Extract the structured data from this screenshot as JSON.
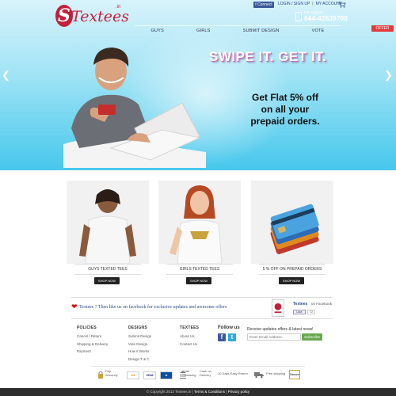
{
  "brand": {
    "logo_letter": "S",
    "name": "Textees",
    "tld": ".in"
  },
  "header": {
    "facebook_connect": "f Connect",
    "login": "LOGIN / SIGN UP",
    "account": "MY ACCOUNT",
    "cart_count": "0",
    "support_label": "For Support",
    "support_phone": "044-42639700"
  },
  "nav": {
    "items": [
      "GUYS",
      "GIRLS",
      "SUBMIT DESIGN",
      "VOTE"
    ]
  },
  "offer_tab": "OFFER",
  "hero": {
    "headline": "SWIPE IT. GET IT.",
    "offer_line1": "Get Flat 5% off",
    "offer_line2": "on all your",
    "offer_line3": "prepaid orders."
  },
  "products": [
    {
      "title": "GUYS TEXTED TEES",
      "button": "SHOP NOW"
    },
    {
      "title": "GIRLS TEXTED TEES",
      "button": "SHOP NOW"
    },
    {
      "title": "5 % OFF ON PREPAID ORDERS",
      "button": "SHOP NOW"
    }
  ],
  "facebook_banner": {
    "text": "Textees ? Then like us on facebook for exclusive updates and awesome offers",
    "page_name": "Textees",
    "page_on": "on Facebook",
    "like_label": "Like",
    "like_count": "72"
  },
  "footer": {
    "policies": {
      "title": "POLICIES",
      "items": [
        "Cancel / Return",
        "Shipping & Delivery",
        "Payment"
      ]
    },
    "designs": {
      "title": "DESIGNS",
      "items": [
        "Submit Design",
        "Vote Design",
        "How it Works",
        "Design T & C"
      ]
    },
    "textees": {
      "title": "TEXTEES",
      "items": [
        "About Us",
        "Contact Us"
      ]
    },
    "follow_title": "Follow us",
    "newsletter_title": "Receive updates offers & latest news!",
    "email_placeholder": "Enter Email Address",
    "subscribe_label": "Subscribe"
  },
  "payments": {
    "pay_securely": "Pay Securely",
    "visa": "VISA",
    "net_banking": "Net Banking",
    "cod": "Cash on Delivery",
    "returns": "10 Days Easy Return",
    "free_shipping": "Free shipping",
    "seal": "Secure"
  },
  "copyright": {
    "text": "© Copyright 2012 Textees.in |",
    "terms": "Terms & Conditions",
    "sep": "|",
    "privacy": "Privacy policy"
  }
}
